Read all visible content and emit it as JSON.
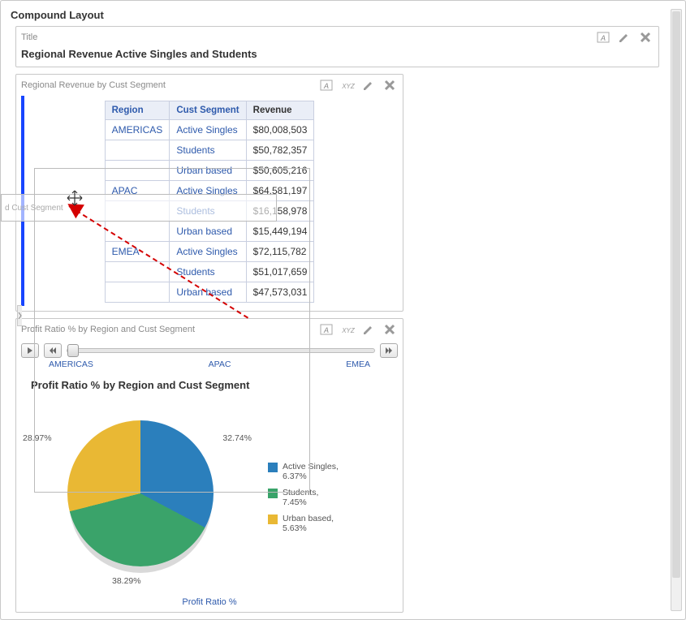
{
  "page": {
    "title": "Compound Layout"
  },
  "title_panel": {
    "label": "Title",
    "text": "Regional Revenue Active Singles and Students"
  },
  "table_panel": {
    "label": "Regional Revenue by Cust Segment",
    "columns": {
      "region": "Region",
      "segment": "Cust Segment",
      "revenue": "Revenue"
    },
    "rows": [
      {
        "region": "AMERICAS",
        "segment": "Active Singles",
        "revenue": "$80,008,503"
      },
      {
        "region": "",
        "segment": "Students",
        "revenue": "$50,782,357"
      },
      {
        "region": "",
        "segment": "Urban based",
        "revenue": "$50,605,216"
      },
      {
        "region": "APAC",
        "segment": "Active Singles",
        "revenue": "$64,581,197"
      },
      {
        "region": "",
        "segment": "Students",
        "revenue": "$16,158,978"
      },
      {
        "region": "",
        "segment": "Urban based",
        "revenue": "$15,449,194"
      },
      {
        "region": "EMEA",
        "segment": "Active Singles",
        "revenue": "$72,115,782"
      },
      {
        "region": "",
        "segment": "Students",
        "revenue": "$51,017,659"
      },
      {
        "region": "",
        "segment": "Urban based",
        "revenue": "$47,573,031"
      }
    ]
  },
  "ghost": {
    "label": "d Cust Segment"
  },
  "chart_panel": {
    "label": "Profit Ratio % by Region and Cust Segment",
    "slider_labels": [
      "AMERICAS",
      "APAC",
      "EMEA"
    ],
    "chart_title": "Profit Ratio % by Region and Cust Segment",
    "axis_label": "Profit Ratio %",
    "legend": [
      {
        "name": "Active Singles,",
        "value": "6.37%",
        "color": "#2b7fbc"
      },
      {
        "name": "Students,",
        "value": "7.45%",
        "color": "#3aa36a"
      },
      {
        "name": "Urban based,",
        "value": "5.63%",
        "color": "#e9b834"
      }
    ],
    "slice_labels": {
      "a": "32.74%",
      "b": "38.29%",
      "c": "28.97%"
    }
  },
  "chart_data": {
    "type": "pie",
    "title": "Profit Ratio % by Region and Cust Segment",
    "series": [
      {
        "name": "Active Singles",
        "value": 32.74,
        "legend_value": 6.37,
        "color": "#2b7fbc"
      },
      {
        "name": "Students",
        "value": 38.29,
        "legend_value": 7.45,
        "color": "#3aa36a"
      },
      {
        "name": "Urban based",
        "value": 28.97,
        "legend_value": 5.63,
        "color": "#e9b834"
      }
    ],
    "xlabel": "Profit Ratio %"
  },
  "icons": {
    "format": "A",
    "xyz": "XYZ"
  }
}
